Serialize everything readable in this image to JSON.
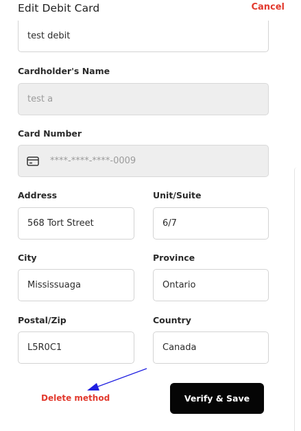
{
  "header": {
    "title": "Edit Debit Card",
    "cancel_label": "Cancel"
  },
  "form": {
    "card_nickname_value": "test debit",
    "cardholder": {
      "label": "Cardholder's Name",
      "value": "test a"
    },
    "card_number": {
      "label": "Card Number",
      "value": "****-****-****-0009",
      "icon": "credit-card-icon"
    },
    "address": {
      "label": "Address",
      "value": "568 Tort Street"
    },
    "unit": {
      "label": "Unit/Suite",
      "value": "6/7"
    },
    "city": {
      "label": "City",
      "value": "Mississuaga"
    },
    "province": {
      "label": "Province",
      "value": "Ontario"
    },
    "postal": {
      "label": "Postal/Zip",
      "value": "L5R0C1"
    },
    "country": {
      "label": "Country",
      "value": "Canada"
    }
  },
  "actions": {
    "delete_label": "Delete method",
    "verify_label": "Verify & Save"
  },
  "colors": {
    "accent_red": "#e23a2e",
    "button_black": "#050505",
    "annotation_blue": "#1f1fe0"
  }
}
